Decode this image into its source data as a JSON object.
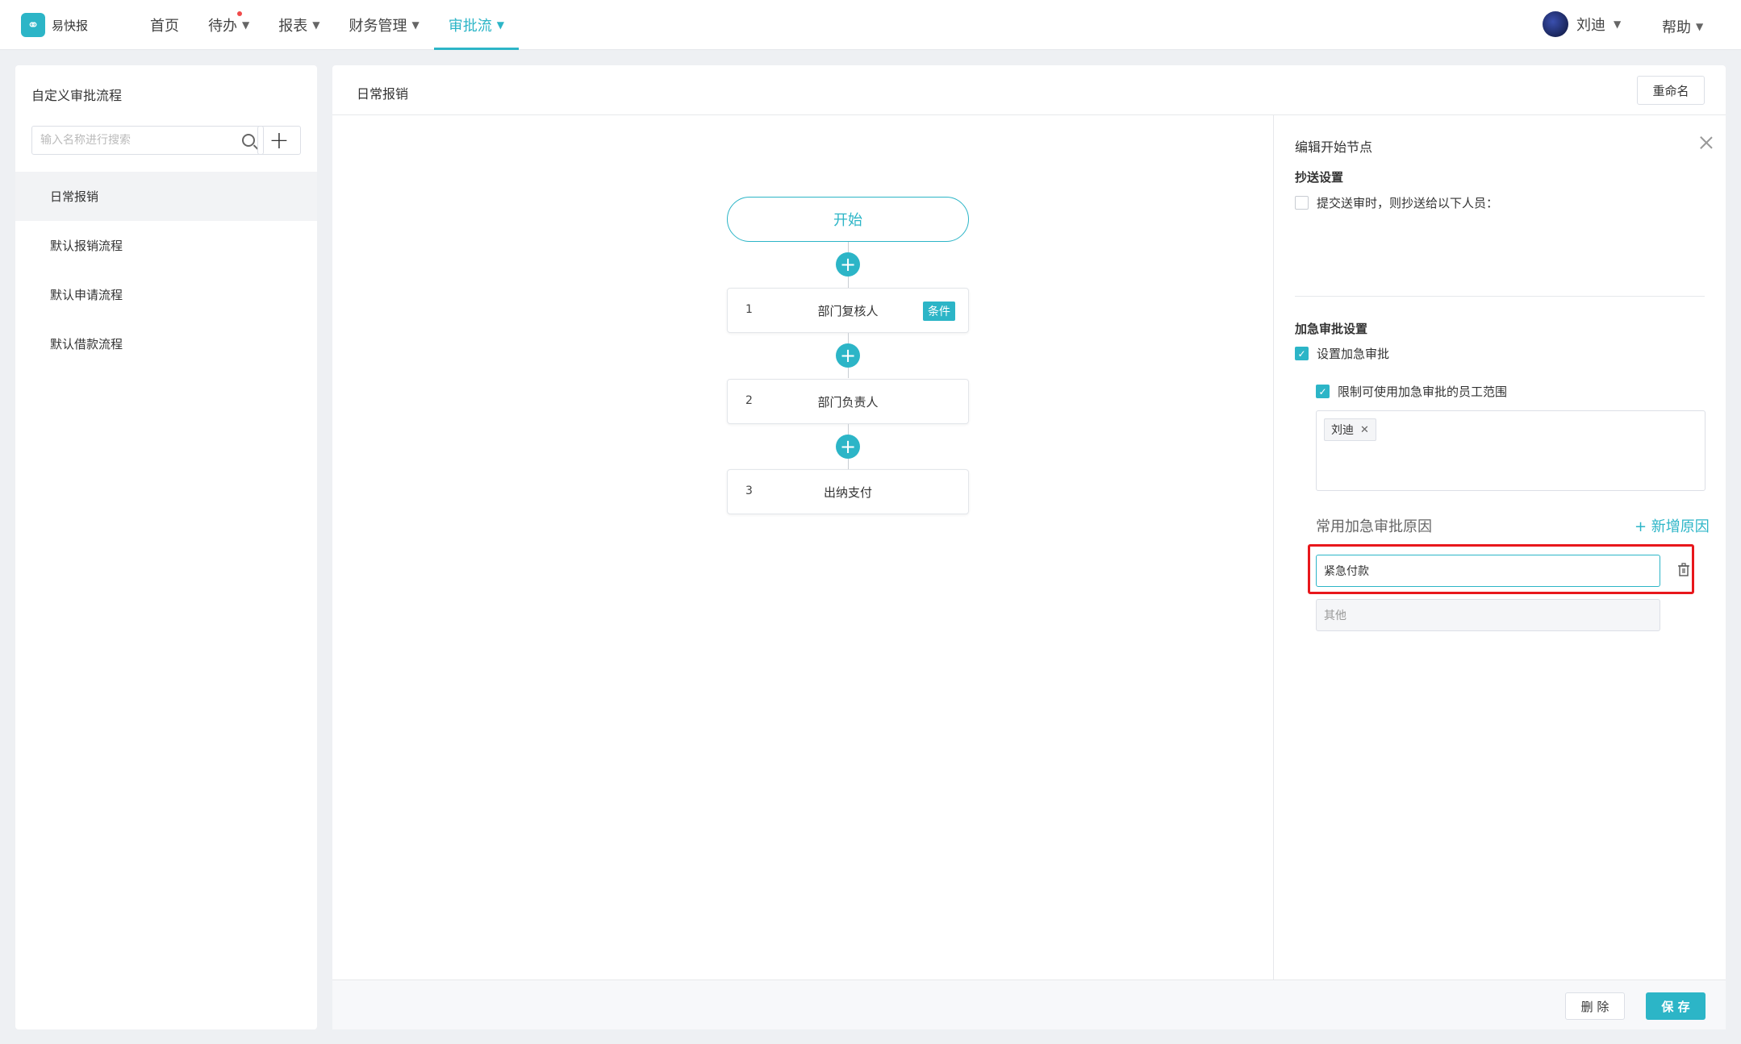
{
  "app": {
    "logo_text": "易快报"
  },
  "nav": {
    "items": [
      {
        "label": "首页",
        "has_caret": false
      },
      {
        "label": "待办",
        "has_caret": true,
        "has_dot": true
      },
      {
        "label": "报表",
        "has_caret": true
      },
      {
        "label": "财务管理",
        "has_caret": true
      },
      {
        "label": "审批流",
        "has_caret": true,
        "active": true
      }
    ],
    "user_name": "刘迪",
    "help_label": "帮助"
  },
  "sidebar": {
    "title": "自定义审批流程",
    "search_placeholder": "输入名称进行搜索",
    "add_label": "+",
    "items": [
      {
        "label": "日常报销",
        "selected": true
      },
      {
        "label": "默认报销流程"
      },
      {
        "label": "默认申请流程"
      },
      {
        "label": "默认借款流程"
      }
    ]
  },
  "main": {
    "title": "日常报销",
    "rename_label": "重命名",
    "flow": {
      "start_label": "开始",
      "steps": [
        {
          "num": "1",
          "label": "部门复核人",
          "badge": "条件"
        },
        {
          "num": "2",
          "label": "部门负责人"
        },
        {
          "num": "3",
          "label": "出纳支付"
        }
      ]
    },
    "delete_label": "删 除",
    "save_label": "保 存"
  },
  "edit_panel": {
    "title": "编辑开始节点",
    "cc_section": "抄送设置",
    "cc_checkbox_label": "提交送审时，则抄送给以下人员：",
    "cc_checked": false,
    "urgent_section": "加急审批设置",
    "urgent_checkbox_label": "设置加急审批",
    "urgent_checked": true,
    "limit_checkbox_label": "限制可使用加急审批的员工范围",
    "limit_checked": true,
    "tags": [
      "刘迪"
    ],
    "reason_title": "常用加急审批原因",
    "add_reason_label": "+ 新增原因",
    "reasons": [
      "紧急付款",
      "其他"
    ]
  },
  "colors": {
    "accent": "#2cb5c7",
    "highlight_frame": "#e8171c"
  }
}
